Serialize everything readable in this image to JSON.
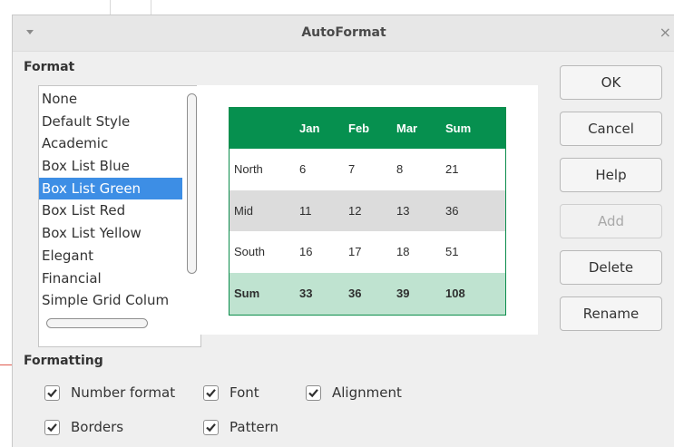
{
  "dialog": {
    "title": "AutoFormat",
    "close_glyph": "×",
    "menu_icon": "chevron-down-icon"
  },
  "format": {
    "label": "Format",
    "items": [
      "None",
      "Default Style",
      "Academic",
      "Box List Blue",
      "Box List Green",
      "Box List Red",
      "Box List Yellow",
      "Elegant",
      "Financial",
      "Simple Grid Colum"
    ],
    "selected": "Box List Green",
    "selected_color": "#3d8ee5"
  },
  "preview": {
    "header": [
      "",
      "Jan",
      "Feb",
      "Mar",
      "Sum"
    ],
    "rows": [
      [
        "North",
        "6",
        "7",
        "8",
        "21"
      ],
      [
        "Mid",
        "11",
        "12",
        "13",
        "36"
      ],
      [
        "South",
        "16",
        "17",
        "18",
        "51"
      ]
    ],
    "total": [
      "Sum",
      "33",
      "36",
      "39",
      "108"
    ],
    "colors": {
      "header_bg": "#06904f",
      "alt_row_bg": "#dcdcdc",
      "total_bg": "#bfe3d0"
    }
  },
  "buttons": {
    "ok": "OK",
    "cancel": "Cancel",
    "help": "Help",
    "add": "Add",
    "delete": "Delete",
    "rename": "Rename"
  },
  "formatting": {
    "label": "Formatting",
    "options": {
      "number_format": {
        "label": "Number format",
        "checked": true
      },
      "font": {
        "label": "Font",
        "checked": true
      },
      "alignment": {
        "label": "Alignment",
        "checked": true
      },
      "borders": {
        "label": "Borders",
        "checked": true
      },
      "pattern": {
        "label": "Pattern",
        "checked": true
      }
    }
  }
}
